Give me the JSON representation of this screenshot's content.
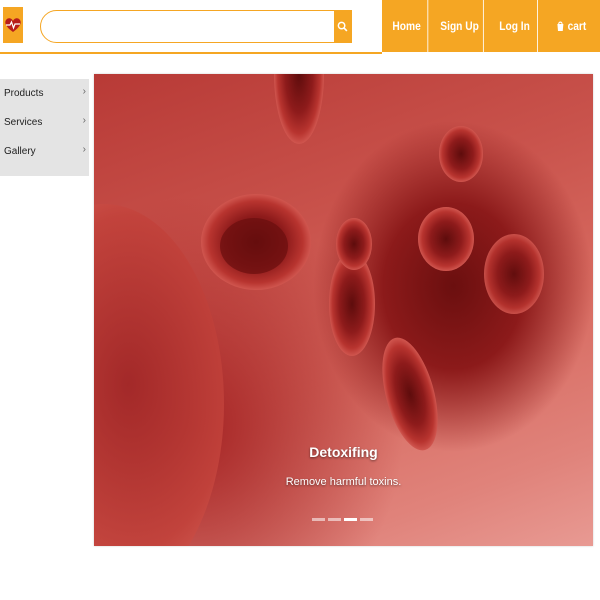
{
  "brand": {
    "accent_color": "#f5a623",
    "logo_icon": "heart-pulse-icon"
  },
  "search": {
    "value": "",
    "placeholder": "",
    "button_icon": "search-icon"
  },
  "nav": {
    "items": [
      {
        "label": "Home"
      },
      {
        "label": "Sign Up"
      },
      {
        "label": "Log In"
      },
      {
        "label": "cart",
        "icon": "cart-icon"
      }
    ]
  },
  "sidebar": {
    "items": [
      {
        "label": "Products"
      },
      {
        "label": "Services"
      },
      {
        "label": "Gallery"
      }
    ]
  },
  "carousel": {
    "slide": {
      "title": "Detoxifing",
      "subtitle": "Remove harmful toxins."
    },
    "slide_count": 4,
    "active_index": 2
  }
}
